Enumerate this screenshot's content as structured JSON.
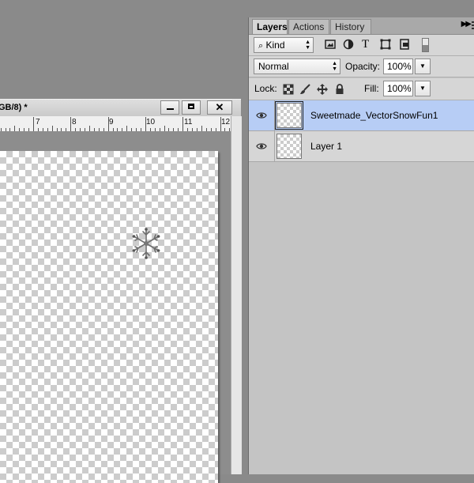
{
  "document": {
    "title": "GB/8) *",
    "ruler_numbers": [
      "7",
      "8",
      "9",
      "10",
      "11",
      "12"
    ]
  },
  "panel": {
    "tabs": [
      {
        "label": "Layers",
        "active": true
      },
      {
        "label": "Actions",
        "active": false
      },
      {
        "label": "History",
        "active": false
      }
    ],
    "filter": {
      "kind_label": "Kind"
    },
    "blend_mode": "Normal",
    "opacity_label": "Opacity:",
    "opacity_value": "100%",
    "lock_label": "Lock:",
    "fill_label": "Fill:",
    "fill_value": "100%",
    "layers": [
      {
        "name": "Sweetmade_VectorSnowFun1",
        "selected": true,
        "visible": true
      },
      {
        "name": "Layer 1",
        "selected": false,
        "visible": true
      }
    ]
  },
  "colors": {
    "selected_layer": "#b7cdf5",
    "workspace": "#8a8a8a"
  }
}
